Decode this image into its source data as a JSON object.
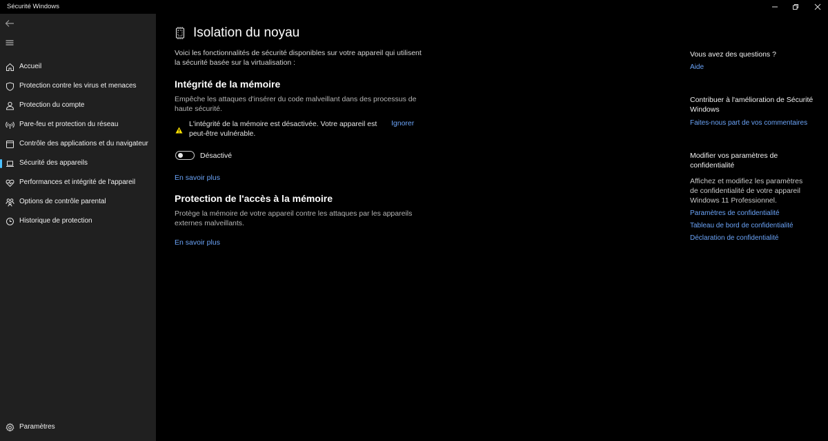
{
  "window": {
    "title": "Sécurité Windows"
  },
  "sidebar": {
    "items": [
      {
        "label": "Accueil",
        "icon": "home-icon"
      },
      {
        "label": "Protection contre les virus et menaces",
        "icon": "shield-icon"
      },
      {
        "label": "Protection du compte",
        "icon": "person-icon"
      },
      {
        "label": "Pare-feu et protection du réseau",
        "icon": "wifi-antenna-icon"
      },
      {
        "label": "Contrôle des applications et du navigateur",
        "icon": "app-window-icon"
      },
      {
        "label": "Sécurité des appareils",
        "icon": "laptop-icon",
        "active": true
      },
      {
        "label": "Performances et intégrité de l'appareil",
        "icon": "heart-pulse-icon"
      },
      {
        "label": "Options de contrôle parental",
        "icon": "family-icon"
      },
      {
        "label": "Historique de protection",
        "icon": "history-icon"
      }
    ],
    "settings_label": "Paramètres"
  },
  "main": {
    "title": "Isolation du noyau",
    "intro": "Voici les fonctionnalités de sécurité disponibles sur votre appareil qui utilisent la sécurité basée sur la virtualisation :",
    "memory_integrity": {
      "heading": "Intégrité de la mémoire",
      "description": "Empêche les attaques d'insérer du code malveillant dans des processus de haute sécurité.",
      "warning": "L'intégrité de la mémoire est désactivée. Votre appareil est peut-être vulnérable.",
      "ignore_label": "Ignorer",
      "toggle_state": "Désactivé",
      "learn_more": "En savoir plus"
    },
    "memory_access": {
      "heading": "Protection de l'accès à la mémoire",
      "description": "Protège la mémoire de votre appareil contre les attaques par les appareils externes malveillants.",
      "learn_more": "En savoir plus"
    }
  },
  "right": {
    "questions_heading": "Vous avez des questions ?",
    "help_link": "Aide",
    "contribute_heading": "Contribuer à l'amélioration de Sécurité Windows",
    "feedback_link": "Faites-nous part de vos commentaires",
    "privacy_heading": "Modifier vos paramètres de confidentialité",
    "privacy_text": "Affichez et modifiez les paramètres de confidentialité de votre appareil Windows 11 Professionnel.",
    "privacy_links": [
      "Paramètres de confidentialité",
      "Tableau de bord de confidentialité",
      "Déclaration de confidentialité"
    ]
  },
  "colors": {
    "accent": "#4cc2ff",
    "link": "#6ba4f8",
    "warning": "#fce100",
    "sidebar_bg": "#202020",
    "main_bg": "#000000"
  }
}
